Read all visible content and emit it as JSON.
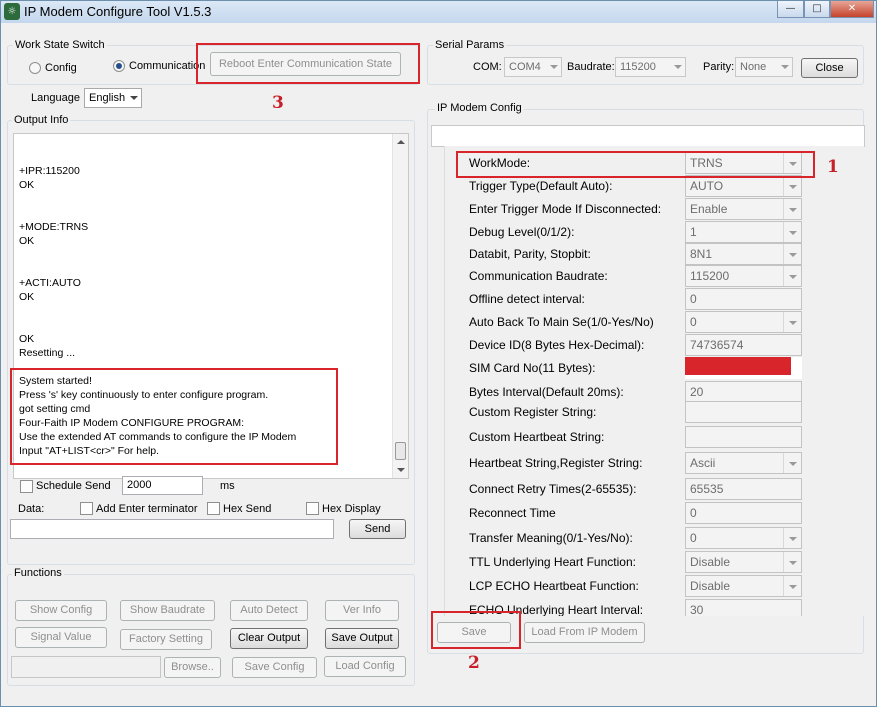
{
  "window": {
    "title": "IP Modem Configure Tool V1.5.3",
    "minimize": "—",
    "maximize": "□",
    "close": "✕"
  },
  "work_state": {
    "group_label": "Work State Switch",
    "radio_config": "Config",
    "radio_communication": "Communication",
    "selected": "Communication",
    "reboot_button": "Reboot Enter Communication State",
    "language_label": "Language",
    "language_value": "English"
  },
  "serial_params": {
    "group_label": "Serial Params",
    "com_label": "COM:",
    "com_value": "COM4",
    "baudrate_label": "Baudrate:",
    "baudrate_value": "115200",
    "parity_label": "Parity:",
    "parity_value": "None",
    "close_button": "Close"
  },
  "output_info": {
    "group_label": "Output Info",
    "lines": [
      "+IPR:115200",
      "OK",
      "+MODE:TRNS",
      "OK",
      "+ACTI:AUTO",
      "OK",
      "OK",
      "Resetting ...",
      "System started!",
      "Press 's' key continuously to enter configure program.",
      "got setting cmd",
      "Four-Faith IP Modem CONFIGURE PROGRAM:",
      "Use the extended AT commands to configure the IP Modem",
      "Input \"AT+LIST<cr>\" For help."
    ]
  },
  "send": {
    "schedule_send_label": "Schedule Send",
    "schedule_value": "2000",
    "ms_label": "ms",
    "data_label": "Data:",
    "add_enter_label": "Add Enter terminator",
    "hex_send_label": "Hex Send",
    "hex_display_label": "Hex Display",
    "send_button": "Send"
  },
  "functions": {
    "group_label": "Functions",
    "show_config": "Show Config",
    "show_baudrate": "Show Baudrate",
    "auto_detect": "Auto Detect",
    "ver_info": "Ver Info",
    "signal_value": "Signal Value",
    "factory_setting": "Factory Setting",
    "clear_output": "Clear Output",
    "save_output": "Save Output",
    "browse": "Browse..",
    "save_config": "Save Config",
    "load_config": "Load Config"
  },
  "ip_modem_config": {
    "group_label": "IP Modem Config",
    "rows": [
      {
        "label": "WorkMode:",
        "value": "TRNS",
        "type": "dropdown"
      },
      {
        "label": "Trigger Type(Default Auto):",
        "value": "AUTO",
        "type": "dropdown"
      },
      {
        "label": "Enter Trigger Mode If Disconnected:",
        "value": "Enable",
        "type": "dropdown"
      },
      {
        "label": "Debug Level(0/1/2):",
        "value": "1",
        "type": "dropdown"
      },
      {
        "label": "Databit, Parity, Stopbit:",
        "value": "8N1",
        "type": "dropdown"
      },
      {
        "label": "Communication Baudrate:",
        "value": "115200",
        "type": "dropdown"
      },
      {
        "label": "Offline detect interval:",
        "value": "0",
        "type": "text"
      },
      {
        "label": "Auto Back To Main Se(1/0-Yes/No)",
        "value": "0",
        "type": "dropdown"
      },
      {
        "label": "Device ID(8 Bytes Hex-Decimal):",
        "value": "74736574",
        "type": "text"
      },
      {
        "label": "SIM Card No(11 Bytes):",
        "value": "",
        "type": "redacted"
      },
      {
        "label": "Bytes Interval(Default 20ms):",
        "value": "20",
        "type": "text"
      },
      {
        "label": "Custom Register String:",
        "value": "",
        "type": "text"
      },
      {
        "label": "Custom Heartbeat String:",
        "value": "",
        "type": "text"
      },
      {
        "label": "Heartbeat String,Register String:",
        "value": "Ascii",
        "type": "dropdown"
      },
      {
        "label": "Connect Retry Times(2-65535):",
        "value": "65535",
        "type": "text"
      },
      {
        "label": "Reconnect Time",
        "value": "0",
        "type": "text"
      },
      {
        "label": "Transfer Meaning(0/1-Yes/No):",
        "value": "0",
        "type": "dropdown"
      },
      {
        "label": "TTL Underlying Heart Function:",
        "value": "Disable",
        "type": "dropdown"
      },
      {
        "label": "LCP ECHO Heartbeat Function:",
        "value": "Disable",
        "type": "dropdown"
      },
      {
        "label": "ECHO Underlying Heart Interval:",
        "value": "30",
        "type": "text"
      }
    ],
    "save_button": "Save",
    "load_button": "Load From IP Modem"
  },
  "annotations": {
    "one": "1",
    "two": "2",
    "three": "3",
    "color": "#d8252b"
  }
}
